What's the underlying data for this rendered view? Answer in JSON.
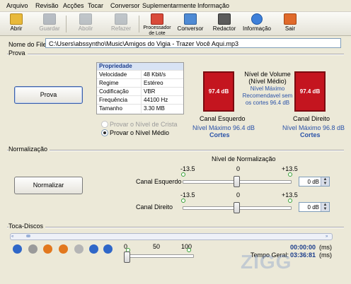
{
  "menu": [
    "Arquivo",
    "Revisão",
    "Acções",
    "Tocar",
    "Conversor",
    "Suplementarmente",
    "Informação"
  ],
  "toolbar": {
    "open": "Abrir",
    "save": "Guardar",
    "abort": "Abolir",
    "redo": "Refazer",
    "batch_line1": "Processador",
    "batch_line2": "de Lote",
    "converter": "Conversor",
    "editor": "Redactor",
    "info": "Informação",
    "exit": "Sair"
  },
  "file": {
    "label": "Nome do File:",
    "path": "C:\\Users\\abssyntho\\Music\\Amigos do Vigia - Trazer Você Aqui.mp3"
  },
  "prova": {
    "group_title": "Prova",
    "button": "Prova",
    "properties": {
      "header": "Propriedade",
      "rows": [
        {
          "k": "Velocidade",
          "v": "48 Kbit/s"
        },
        {
          "k": "Regime",
          "v": "Estéreo"
        },
        {
          "k": "Codificação",
          "v": "VBR"
        },
        {
          "k": "Frequência",
          "v": "44100 Hz"
        },
        {
          "k": "Tamanho",
          "v": "3.30 MB"
        }
      ]
    },
    "radio_peak": "Provar o Nível de Crista",
    "radio_avg": "Provar o Nível Médio",
    "left_db": "97.4 dB",
    "right_db": "97.4 dB",
    "left_label": "Canal Esquerdo",
    "right_label": "Canal Direito",
    "left_max": "Nível Máximo 96.4 dB",
    "right_max": "Nível Máximo 96.8 dB",
    "left_cuts": "Cortes",
    "right_cuts": "Cortes",
    "volume_title_1": "Nível de Volume",
    "volume_title_2": "(Nível Médio)",
    "recommend_1": "Nível Máximo",
    "recommend_2": "Recomendavel sem",
    "recommend_3": "os cortes 96.4 dB"
  },
  "norm": {
    "group_title": "Normalização",
    "button": "Normalizar",
    "level_title": "Nível de Normalização",
    "left_label": "Canal Esquerdo",
    "right_label": "Canal Direito",
    "min": "-13.5",
    "zero": "0",
    "max": "+13.5",
    "left_value": "0 dB",
    "right_value": "0 dB",
    "left_level": 0,
    "right_level": 0
  },
  "player": {
    "group_title": "Toca-Discos",
    "vol_0": "0",
    "vol_50": "50",
    "vol_100": "100",
    "time": "00:00:00",
    "time_unit": "(ms)",
    "total_label": "Tempo Geral:",
    "total": "03:36:81",
    "total_unit": "(ms)"
  },
  "watermark": "ZIGG",
  "colors": {
    "meter_red": "#c4151f",
    "link_blue": "#2a52a8"
  }
}
